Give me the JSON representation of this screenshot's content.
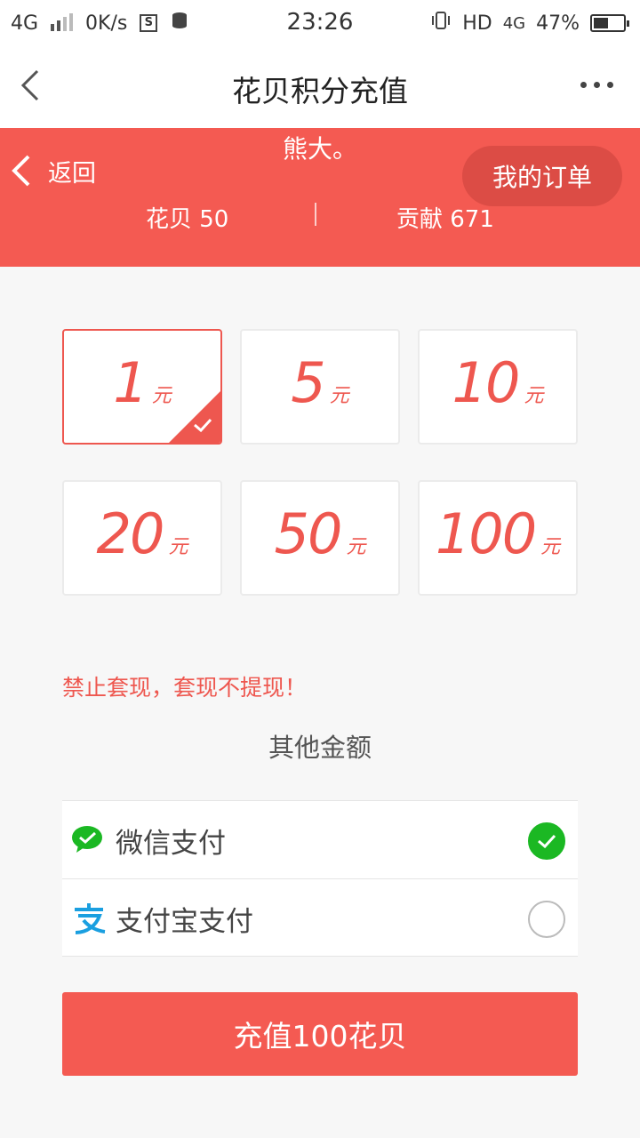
{
  "status_bar": {
    "network": "4G",
    "speed": "0K/s",
    "time": "23:26",
    "hd": "HD",
    "network2": "4G",
    "battery": "47%"
  },
  "navbar": {
    "title": "花贝积分充值"
  },
  "banner": {
    "back_label": "返回",
    "username": "熊大。",
    "order_button": "我的订单",
    "huabei_label": "花贝 50",
    "contribution_label": "贡献 671"
  },
  "amounts": [
    {
      "value": "1",
      "unit": "元",
      "selected": true
    },
    {
      "value": "5",
      "unit": "元",
      "selected": false
    },
    {
      "value": "10",
      "unit": "元",
      "selected": false
    },
    {
      "value": "20",
      "unit": "元",
      "selected": false
    },
    {
      "value": "50",
      "unit": "元",
      "selected": false
    },
    {
      "value": "100",
      "unit": "元",
      "selected": false
    }
  ],
  "warning": "禁止套现，套现不提现！",
  "other_amount": "其他金额",
  "payment": {
    "wechat": {
      "label": "微信支付",
      "selected": true
    },
    "alipay": {
      "label": "支付宝支付",
      "selected": false
    }
  },
  "submit_label": "充值100花贝",
  "colors": {
    "accent": "#f45a52",
    "wechat_green": "#1bb823",
    "alipay_blue": "#1a9fe0"
  }
}
